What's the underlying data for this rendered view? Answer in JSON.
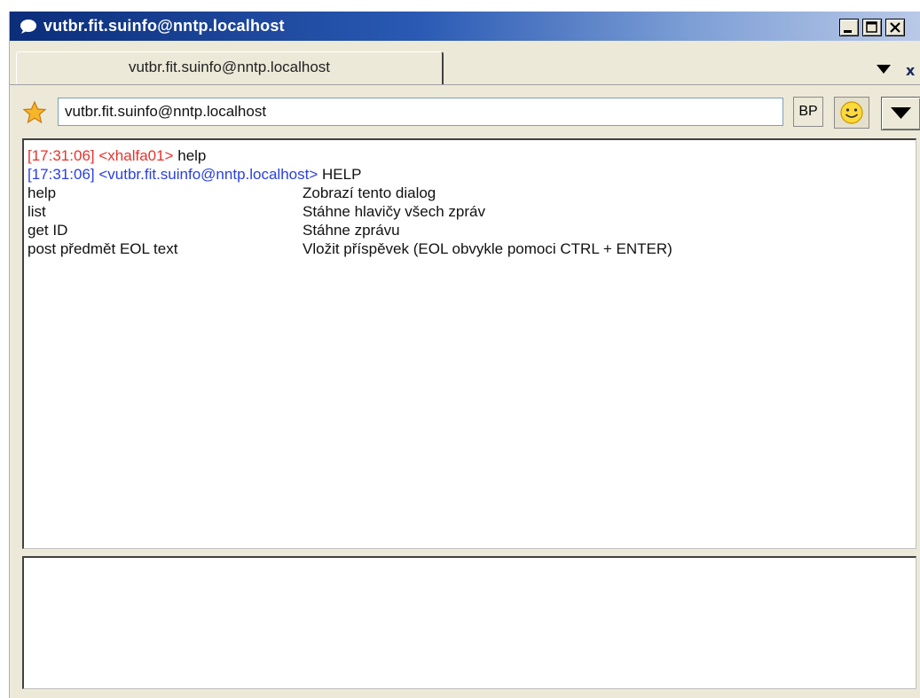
{
  "window": {
    "title": "vutbr.fit.suinfo@nntp.localhost",
    "minimize_icon": "minimize-icon",
    "maximize_icon": "maximize-icon",
    "close_icon": "close-icon"
  },
  "tabs": [
    {
      "label": "vutbr.fit.suinfo@nntp.localhost",
      "active": true
    }
  ],
  "tabbar": {
    "dropdown_icon": "chevron-down-icon",
    "close_label": "x"
  },
  "address": {
    "value": "vutbr.fit.suinfo@nntp.localhost",
    "favorite_icon": "star-icon",
    "bp_label": "BP",
    "emoticon_icon": "smiley-icon",
    "menu_icon": "triangle-down-icon"
  },
  "log": {
    "messages": [
      {
        "time": "[17:31:06]",
        "nick": "<xhalfa01>",
        "text": "help",
        "color": "#e8322c"
      },
      {
        "time": "[17:31:06]",
        "nick": "<vutbr.fit.suinfo@nntp.localhost>",
        "text": "HELP",
        "color": "#2a40e0"
      }
    ],
    "help_rows": [
      {
        "command": "help",
        "description": "Zobrazí tento dialog"
      },
      {
        "command": "list",
        "description": "Stáhne hlavičy všech zpráv"
      },
      {
        "command": "get ID",
        "description": "Stáhne zprávu"
      },
      {
        "command": "post předmět EOL text",
        "description": "Vložit příspěvek (EOL obvykle pomoci CTRL + ENTER)"
      }
    ]
  },
  "input": {
    "value": ""
  },
  "colors": {
    "title_gradient_start": "#0b2d7a",
    "title_gradient_end": "#b9c9e8",
    "window_bg": "#ece9d8",
    "incoming_nick": "#e8322c",
    "outgoing_nick": "#2a40e0"
  }
}
